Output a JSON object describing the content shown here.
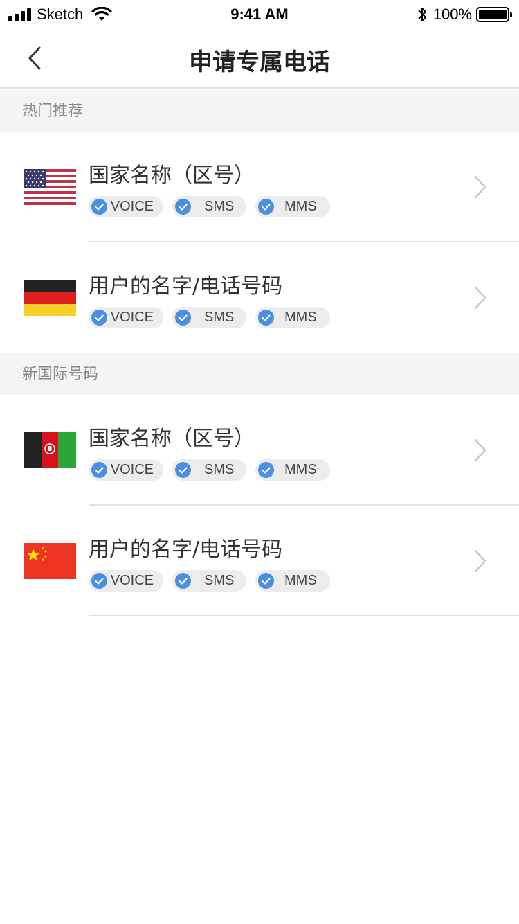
{
  "status_bar": {
    "carrier": "Sketch",
    "time": "9:41 AM",
    "battery": "100%"
  },
  "nav": {
    "title": "申请专属电话",
    "back_icon": "chevron-left-icon"
  },
  "sections": [
    {
      "header": "热门推荐",
      "items": [
        {
          "flag": "us-flag-icon",
          "title": "国家名称（区号）",
          "tags": [
            "VOICE",
            "SMS",
            "MMS"
          ]
        },
        {
          "flag": "de-flag-icon",
          "title": "用户的名字/电话号码",
          "tags": [
            "VOICE",
            "SMS",
            "MMS"
          ]
        }
      ]
    },
    {
      "header": "新国际号码",
      "items": [
        {
          "flag": "af-flag-icon",
          "title": "国家名称（区号）",
          "tags": [
            "VOICE",
            "SMS",
            "MMS"
          ]
        },
        {
          "flag": "cn-flag-icon",
          "title": "用户的名字/电话号码",
          "tags": [
            "VOICE",
            "SMS",
            "MMS"
          ]
        }
      ]
    }
  ],
  "colors": {
    "accent": "#4a8fe2",
    "section_bg": "#f4f4f4",
    "divider": "#e2e2e2",
    "tag_bg": "#ececec"
  }
}
